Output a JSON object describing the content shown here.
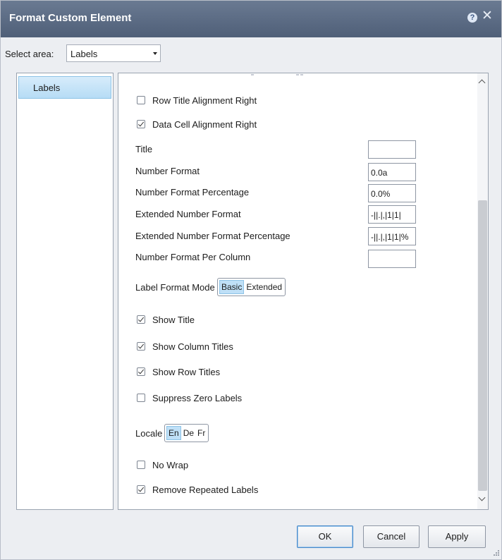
{
  "dialog": {
    "title": "Format Custom Element",
    "help_glyph": "?",
    "close_glyph": "✕"
  },
  "select_area": {
    "label": "Select area:",
    "value": "Labels"
  },
  "left_panel": {
    "items": [
      {
        "label": "Labels"
      }
    ]
  },
  "options": {
    "row_title_alignment_right": {
      "label": "Row Title Alignment Right",
      "checked": false
    },
    "data_cell_alignment_right": {
      "label": "Data Cell Alignment Right",
      "checked": true
    },
    "title": {
      "label": "Title",
      "value": ""
    },
    "number_format": {
      "label": "Number Format",
      "value": "0.0a"
    },
    "number_format_percentage": {
      "label": "Number Format Percentage",
      "value": "0.0%"
    },
    "extended_number_format": {
      "label": "Extended Number Format",
      "value": "-||.|,|1|1|"
    },
    "extended_number_format_percentage": {
      "label": "Extended Number Format Percentage",
      "value": "-||.|,|1|1|%"
    },
    "number_format_per_column": {
      "label": "Number Format Per Column",
      "value": ""
    },
    "label_format_mode": {
      "label": "Label Format Mode",
      "options": [
        "Basic",
        "Extended"
      ],
      "selected": "Basic"
    },
    "show_title": {
      "label": "Show Title",
      "checked": true
    },
    "show_column_titles": {
      "label": "Show Column Titles",
      "checked": true
    },
    "show_row_titles": {
      "label": "Show Row Titles",
      "checked": true
    },
    "suppress_zero_labels": {
      "label": "Suppress Zero Labels",
      "checked": false
    },
    "locale": {
      "label": "Locale",
      "options": [
        "En",
        "De",
        "Fr"
      ],
      "selected": "En"
    },
    "no_wrap": {
      "label": "No Wrap",
      "checked": false
    },
    "remove_repeated_labels": {
      "label": "Remove Repeated Labels",
      "checked": true
    }
  },
  "buttons": {
    "ok": "OK",
    "cancel": "Cancel",
    "apply": "Apply"
  },
  "colors": {
    "titlebar": "#5a6a84",
    "selected_item": "#bfe0f7",
    "dialog_bg": "#eceef2"
  },
  "icons": {
    "help": "help-icon",
    "close": "close-icon",
    "dropdown": "chevron-down-icon"
  }
}
